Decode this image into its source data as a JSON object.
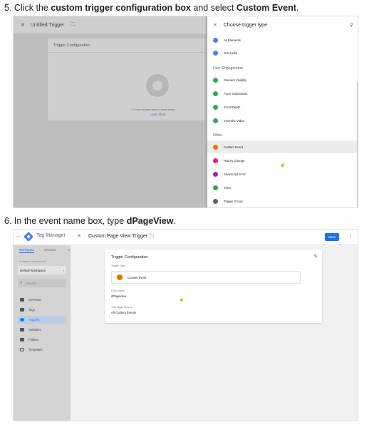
{
  "step5": {
    "num": "5.",
    "pre": "Click the",
    "bold1": "custom trigger configuration box",
    "mid": "and select",
    "bold2": "Custom Event",
    "end": "."
  },
  "step6": {
    "num": "6.",
    "pre": "In the event name box, type",
    "bold1": "dPageView",
    "end": "."
  },
  "shot1": {
    "title": "Untitled Trigger",
    "panel_title": "Trigger Configuration",
    "choose_text": "Choose a trigger type to begin setup...",
    "learn_more": "Learn More",
    "drawer": {
      "title": "Choose trigger type",
      "items_top": [
        {
          "label": "All Elements",
          "color": "#4285f4"
        },
        {
          "label": "Just Links",
          "color": "#4285f4"
        }
      ],
      "section_engagement": "User Engagement",
      "items_engagement": [
        {
          "label": "Element Visibility",
          "color": "#34a853"
        },
        {
          "label": "Form Submission",
          "color": "#34a853"
        },
        {
          "label": "Scroll Depth",
          "color": "#34a853"
        },
        {
          "label": "YouTube Video",
          "color": "#34a853"
        }
      ],
      "section_other": "Other",
      "items_other": [
        {
          "label": "Custom Event",
          "color": "#e8710a"
        },
        {
          "label": "History Change",
          "color": "#e91e63"
        },
        {
          "label": "JavaScript Error",
          "color": "#9c27b0"
        },
        {
          "label": "Timer",
          "color": "#34a853"
        },
        {
          "label": "Trigger Group",
          "color": "#5f6368"
        }
      ]
    }
  },
  "shot2": {
    "brand": "Tag Manager",
    "title": "Custom Page View Trigger",
    "save": "Save",
    "tabs": [
      "Workspace",
      "Versions",
      "A"
    ],
    "current_workspace_label": "CURRENT WORKSPACE",
    "workspace": "Default Workspace",
    "search": "Search",
    "nav": [
      "Overview",
      "Tags",
      "Triggers",
      "Variables",
      "Folders",
      "Templates"
    ],
    "active_nav": "Triggers",
    "card": {
      "title": "Trigger Configuration",
      "trigger_type_label": "Trigger Type",
      "trigger_type": "Custom Event",
      "event_name_label": "Event name",
      "event_name": "dPageview",
      "fires_on_label": "This trigger fires on",
      "fires_on": "All Custom Events"
    }
  }
}
